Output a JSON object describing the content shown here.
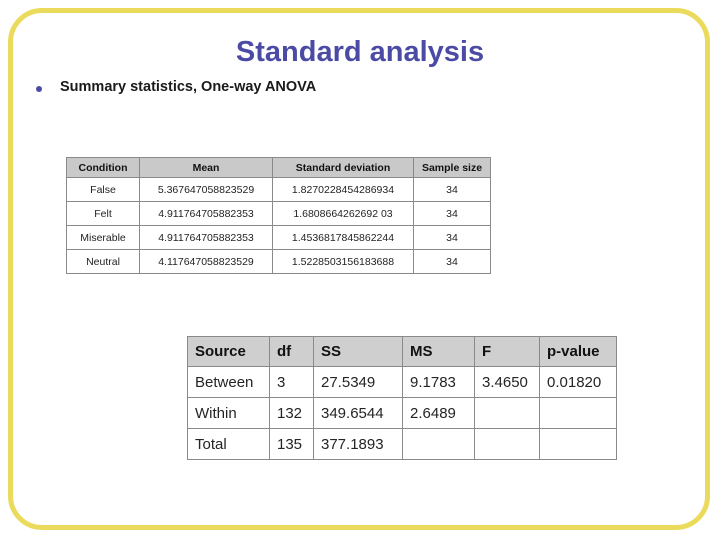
{
  "slide": {
    "title": "Standard analysis",
    "frame_color": "#ebdb5c",
    "title_color": "#4b4ba5",
    "bullets": [
      {
        "marker": "bullet-dot",
        "text": "Summary statistics, One-way ANOVA"
      }
    ]
  },
  "summary_table": {
    "name": "Summary statistics",
    "headers": [
      "Condition",
      "Mean",
      "Standard deviation",
      "Sample size"
    ],
    "rows": [
      [
        "False",
        "5.367647058823529",
        "1.8270228454286934",
        "34"
      ],
      [
        "Felt",
        "4.911764705882353",
        "1.6808664262692 03",
        "34"
      ],
      [
        "Miserable",
        "4.911764705882353",
        "1.4536817845862244",
        "34"
      ],
      [
        "Neutral",
        "4.117647058823529",
        "1.5228503156183688",
        "34"
      ]
    ]
  },
  "anova_table": {
    "name": "One-way ANOVA",
    "headers": [
      "Source",
      "df",
      "SS",
      "MS",
      "F",
      "p-value"
    ],
    "rows": [
      [
        "Between",
        "3",
        "27.5349",
        "9.1783",
        "3.4650",
        "0.01820"
      ],
      [
        "Within",
        "132",
        "349.6544",
        "2.6489",
        "",
        ""
      ],
      [
        "Total",
        "135",
        "377.1893",
        "",
        "",
        ""
      ]
    ]
  }
}
